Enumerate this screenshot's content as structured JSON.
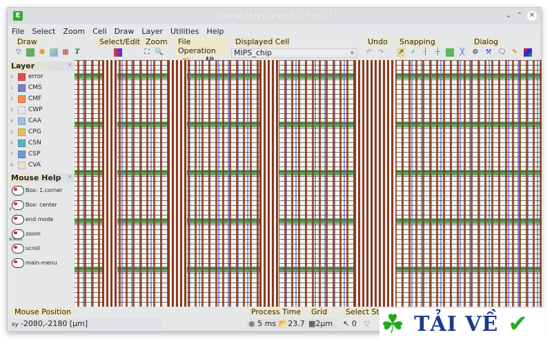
{
  "window": {
    "title": "/home/thies/layouts/chip.cif"
  },
  "menu": [
    "File",
    "Select",
    "Zoom",
    "Cell",
    "Draw",
    "Layer",
    "Utilities",
    "Help"
  ],
  "toolbars": {
    "draw": "Draw",
    "select_edit": "Select/Edit",
    "zoom": "Zoom",
    "file_operation": "File Operation",
    "displayed_cell": "Displayed Cell",
    "displayed_cell_value": "MIPS_chip",
    "undo": "Undo",
    "snapping": "Snapping",
    "dialog": "Dialog"
  },
  "layer_panel": {
    "title": "Layer",
    "items": [
      {
        "num": "0",
        "label": "error",
        "color": "#e05050"
      },
      {
        "num": "1",
        "label": "CMS",
        "color": "#7f7fc8"
      },
      {
        "num": "2",
        "label": "CMF",
        "color": "#ff8c50"
      },
      {
        "num": "3",
        "label": "CWP",
        "color": "#e8e8e8"
      },
      {
        "num": "4",
        "label": "CAA",
        "color": "#9cc4e8"
      },
      {
        "num": "5",
        "label": "CPG",
        "color": "#e8c060"
      },
      {
        "num": "6",
        "label": "CSN",
        "color": "#5aafbf"
      },
      {
        "num": "7",
        "label": "CSP",
        "color": "#6c9cd8"
      },
      {
        "num": "8",
        "label": "CVA",
        "color": "#ebe3d0"
      }
    ]
  },
  "mouse_help": {
    "title": "Mouse Help",
    "items": [
      "Box: 1.corner",
      "Box: center",
      "end mode",
      "zoom",
      "scroll",
      "main-menu"
    ],
    "scroll_tag": "SCROLL",
    "shift_tag": "⇧"
  },
  "status": {
    "mouse_position_label": "Mouse Position",
    "mouse_position": "-2080,-2180 [µm]",
    "xy": "xy",
    "process_time_label": "Process Time",
    "process_time": "5 ms",
    "load_time": "23.7 s",
    "grid_label": "Grid",
    "grid": "2µm",
    "select_status_label": "Select Status",
    "select_count": "0"
  },
  "watermark": "TẢI VỀ"
}
